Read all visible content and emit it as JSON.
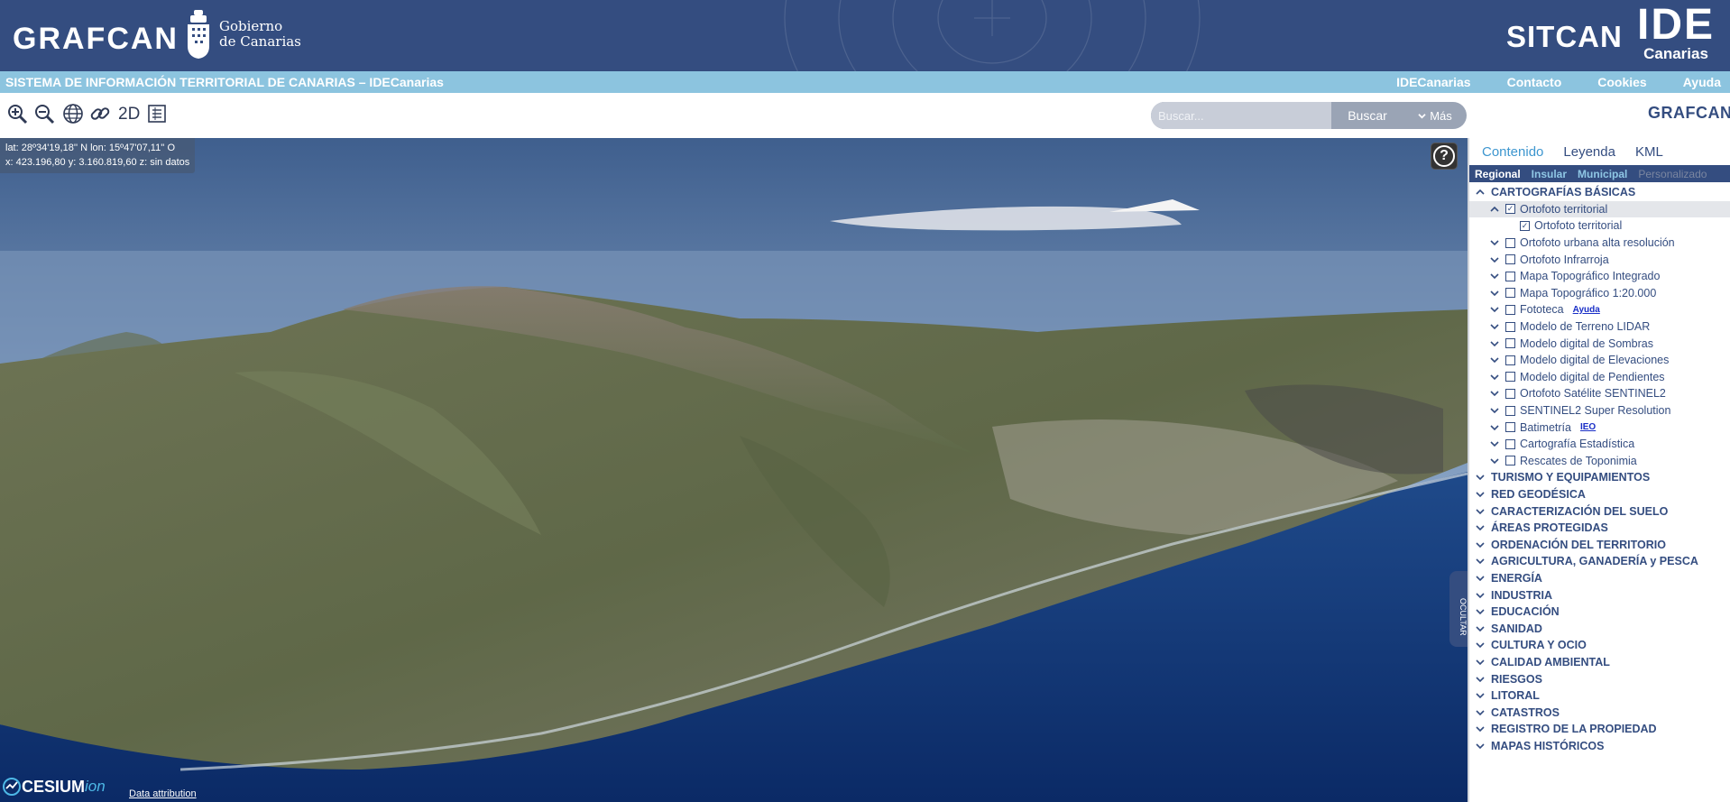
{
  "header": {
    "brand": "GRAFCAN",
    "gobierno_line1": "Gobierno",
    "gobierno_line2": "de Canarias",
    "sitcan": "SITCAN",
    "ide_big": "IDE",
    "ide_small": "Canarias"
  },
  "subbar": {
    "title": "SISTEMA DE INFORMACIÓN TERRITORIAL DE CANARIAS – IDECanarias",
    "nav": [
      "IDECanarias",
      "Contacto",
      "Cookies",
      "Ayuda"
    ]
  },
  "toolbar": {
    "mode_2d": "2D",
    "search_placeholder": "Buscar...",
    "search_button": "Buscar",
    "more_button": "Más",
    "logo_small": "GRAFCAN"
  },
  "map": {
    "coords_line1": "lat: 28º34'19,18'' N  lon:  15º47'07,11'' O",
    "coords_line2": "x: 423.196,80  y: 3.160.819,60  z: sin datos",
    "help": "?",
    "hide_panel": "OCULTAR",
    "cesium": "CESIUM",
    "cesium_ion": "ion",
    "attribution": "Data attribution"
  },
  "panel": {
    "tabs": [
      "Contenido",
      "Leyenda",
      "KML"
    ],
    "subtabs": [
      "Regional",
      "Insular",
      "Municipal",
      "Personalizado"
    ],
    "categories": [
      "CARTOGRAFÍAS BÁSICAS",
      "TURISMO Y EQUIPAMIENTOS",
      "RED GEODÉSICA",
      "CARACTERIZACIÓN DEL SUELO",
      "ÁREAS PROTEGIDAS",
      "ORDENACIÓN DEL TERRITORIO",
      "AGRICULTURA, GANADERÍA y PESCA",
      "ENERGÍA",
      "INDUSTRIA",
      "EDUCACIÓN",
      "SANIDAD",
      "CULTURA Y OCIO",
      "CALIDAD AMBIENTAL",
      "RIESGOS",
      "LITORAL",
      "CATASTROS",
      "REGISTRO DE LA PROPIEDAD",
      "MAPAS HISTÓRICOS"
    ],
    "layers": [
      "Ortofoto territorial",
      "Ortofoto territorial",
      "Ortofoto urbana alta resolución",
      "Ortofoto Infrarroja",
      "Mapa Topográfico Integrado",
      "Mapa Topográfico 1:20.000",
      "Fototeca",
      "Modelo de Terreno LIDAR",
      "Modelo digital de Sombras",
      "Modelo digital de Elevaciones",
      "Modelo digital de Pendientes",
      "Ortofoto Satélite SENTINEL2",
      "SENTINEL2 Super Resolution",
      "Batimetría",
      "Cartografía Estadística",
      "Rescates de Toponimia"
    ],
    "fototeca_link": "Ayuda",
    "batimetria_link": "IEO",
    "checked_layers": [
      "Ortofoto territorial"
    ]
  },
  "colors": {
    "header_bg": "#344d80",
    "subbar_bg": "#8cc4df",
    "active_tab": "#3d96cf",
    "text_primary": "#344d80"
  },
  "icons": [
    "zoom-in-icon",
    "zoom-out-icon",
    "globe-icon",
    "link-icon",
    "print-icon",
    "chevron-down-icon",
    "checkbox-icon",
    "help-icon",
    "cesium-logo-icon",
    "gobierno-shield-icon"
  ]
}
